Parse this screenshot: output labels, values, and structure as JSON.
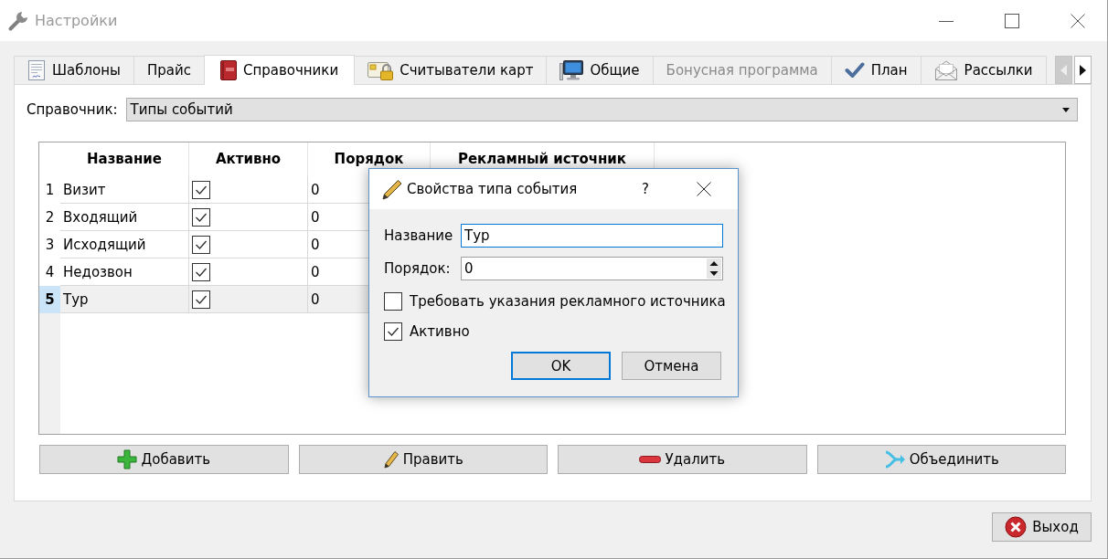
{
  "window": {
    "title": "Настройки"
  },
  "tabs": [
    {
      "label": "Шаблоны",
      "selected": false,
      "disabled": false
    },
    {
      "label": "Прайс",
      "selected": false,
      "disabled": false
    },
    {
      "label": "Справочники",
      "selected": true,
      "disabled": false
    },
    {
      "label": "Считыватели карт",
      "selected": false,
      "disabled": false
    },
    {
      "label": "Общие",
      "selected": false,
      "disabled": false
    },
    {
      "label": "Бонусная программа",
      "selected": false,
      "disabled": true
    },
    {
      "label": "План",
      "selected": false,
      "disabled": false
    },
    {
      "label": "Рассылки",
      "selected": false,
      "disabled": false
    }
  ],
  "tab_scroll": {
    "back_disabled": true,
    "forward_disabled": false
  },
  "directory": {
    "label": "Справочник:",
    "value": "Типы событий"
  },
  "table": {
    "columns": [
      "Название",
      "Активно",
      "Порядок",
      "Рекламный источник"
    ],
    "rows": [
      {
        "number": "1",
        "name": "Визит",
        "active": true,
        "order": "0",
        "selected": false
      },
      {
        "number": "2",
        "name": "Входящий",
        "active": true,
        "order": "0",
        "selected": false
      },
      {
        "number": "3",
        "name": "Исходящий",
        "active": true,
        "order": "0",
        "selected": false
      },
      {
        "number": "4",
        "name": "Недозвон",
        "active": true,
        "order": "0",
        "selected": false
      },
      {
        "number": "5",
        "name": "Тур",
        "active": true,
        "order": "0",
        "selected": true
      }
    ]
  },
  "actions": [
    "Добавить",
    "Править",
    "Удалить",
    "Объединить"
  ],
  "exit_button": "Выход",
  "dialog": {
    "title": "Свойства типа события",
    "help": "?",
    "fields": [
      {
        "kind": "text",
        "label": "Название",
        "value": "Тур",
        "focused": true
      },
      {
        "kind": "spin",
        "label": "Порядок:",
        "value": "0",
        "focused": false
      }
    ],
    "checkboxes": [
      {
        "label": "Требовать указания рекламного источника",
        "checked": false
      },
      {
        "label": "Активно",
        "checked": true
      }
    ],
    "buttons": [
      {
        "label": "OK",
        "default": true
      },
      {
        "label": "Отмена",
        "default": false
      }
    ]
  }
}
